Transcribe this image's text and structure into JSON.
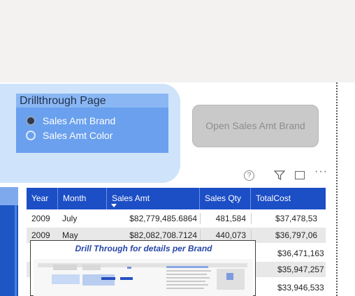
{
  "slicer": {
    "title": "Drillthrough Page",
    "options": [
      {
        "label": "Sales Amt Brand",
        "selected": true
      },
      {
        "label": "Sales Amt Color",
        "selected": false
      }
    ]
  },
  "open_button": {
    "label": "Open Sales Amt Brand"
  },
  "visual_header": {
    "help_icon": "?",
    "more_icon": "···",
    "icons": [
      "help-icon",
      "filter-icon",
      "focus-mode-icon",
      "more-options-icon"
    ]
  },
  "table": {
    "columns": [
      "Year",
      "Month",
      "Sales Amt",
      "Sales Qty",
      "TotalCost"
    ],
    "sort_column": "Sales Amt",
    "rows": [
      {
        "year": "2009",
        "month": "July",
        "sales_amt": "$82,779,485.6864",
        "sales_qty": "481,584",
        "total_cost": "$37,478,53"
      },
      {
        "year": "2009",
        "month": "May",
        "sales_amt": "$82,082,708.7124",
        "sales_qty": "440,073",
        "total_cost": "$36,797,06"
      },
      {
        "year": "",
        "month": "",
        "sales_amt": "",
        "sales_qty": "",
        "total_cost": "$36,471,163"
      },
      {
        "year": "",
        "month": "",
        "sales_amt": "",
        "sales_qty": "",
        "total_cost": "$35,947,257"
      },
      {
        "year": "",
        "month": "",
        "sales_amt": "",
        "sales_qty": "",
        "total_cost": "$33,946,533"
      }
    ]
  },
  "tooltip": {
    "title": "Drill Through for details per Brand"
  },
  "colors": {
    "table_header": "#1c4ec6",
    "slicer_fill": "#6aa0ee",
    "slicer_background": "#cfe4fb",
    "button_disabled": "#c9c9c9",
    "tooltip_title": "#2746a8"
  }
}
